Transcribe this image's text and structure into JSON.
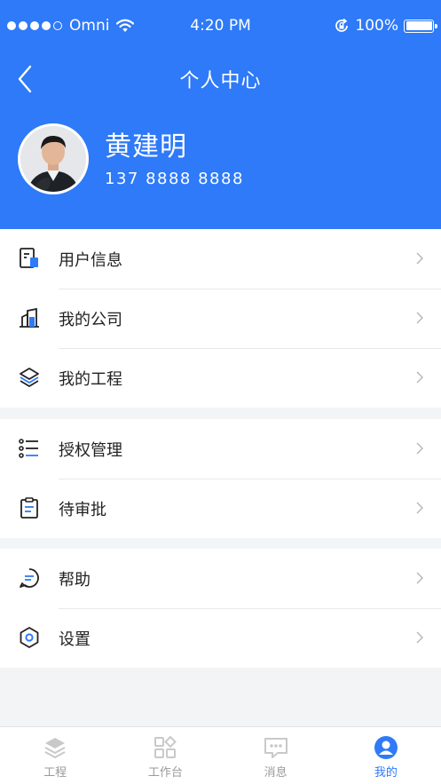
{
  "status_bar": {
    "carrier": "Omni",
    "time": "4:20 PM",
    "battery": "100%"
  },
  "nav": {
    "title": "个人中心"
  },
  "profile": {
    "name": "黄建明",
    "phone": "137 8888 8888"
  },
  "menu_groups": [
    [
      {
        "label": "用户信息",
        "icon": "user-info-icon"
      },
      {
        "label": "我的公司",
        "icon": "company-building-icon"
      },
      {
        "label": "我的工程",
        "icon": "layers-project-icon"
      }
    ],
    [
      {
        "label": "授权管理",
        "icon": "authorization-list-icon"
      },
      {
        "label": "待审批",
        "icon": "clipboard-pending-icon"
      }
    ],
    [
      {
        "label": "帮助",
        "icon": "help-chat-icon"
      },
      {
        "label": "设置",
        "icon": "settings-hexagon-icon"
      }
    ]
  ],
  "tabbar": [
    {
      "label": "工程",
      "icon": "project-layers-icon",
      "active": false
    },
    {
      "label": "工作台",
      "icon": "workbench-grid-icon",
      "active": false
    },
    {
      "label": "消息",
      "icon": "message-bubble-icon",
      "active": false
    },
    {
      "label": "我的",
      "icon": "profile-person-icon",
      "active": true
    }
  ],
  "colors": {
    "primary": "#2e7af8",
    "background": "#f3f4f6",
    "tab_inactive": "#9a9a9a"
  }
}
